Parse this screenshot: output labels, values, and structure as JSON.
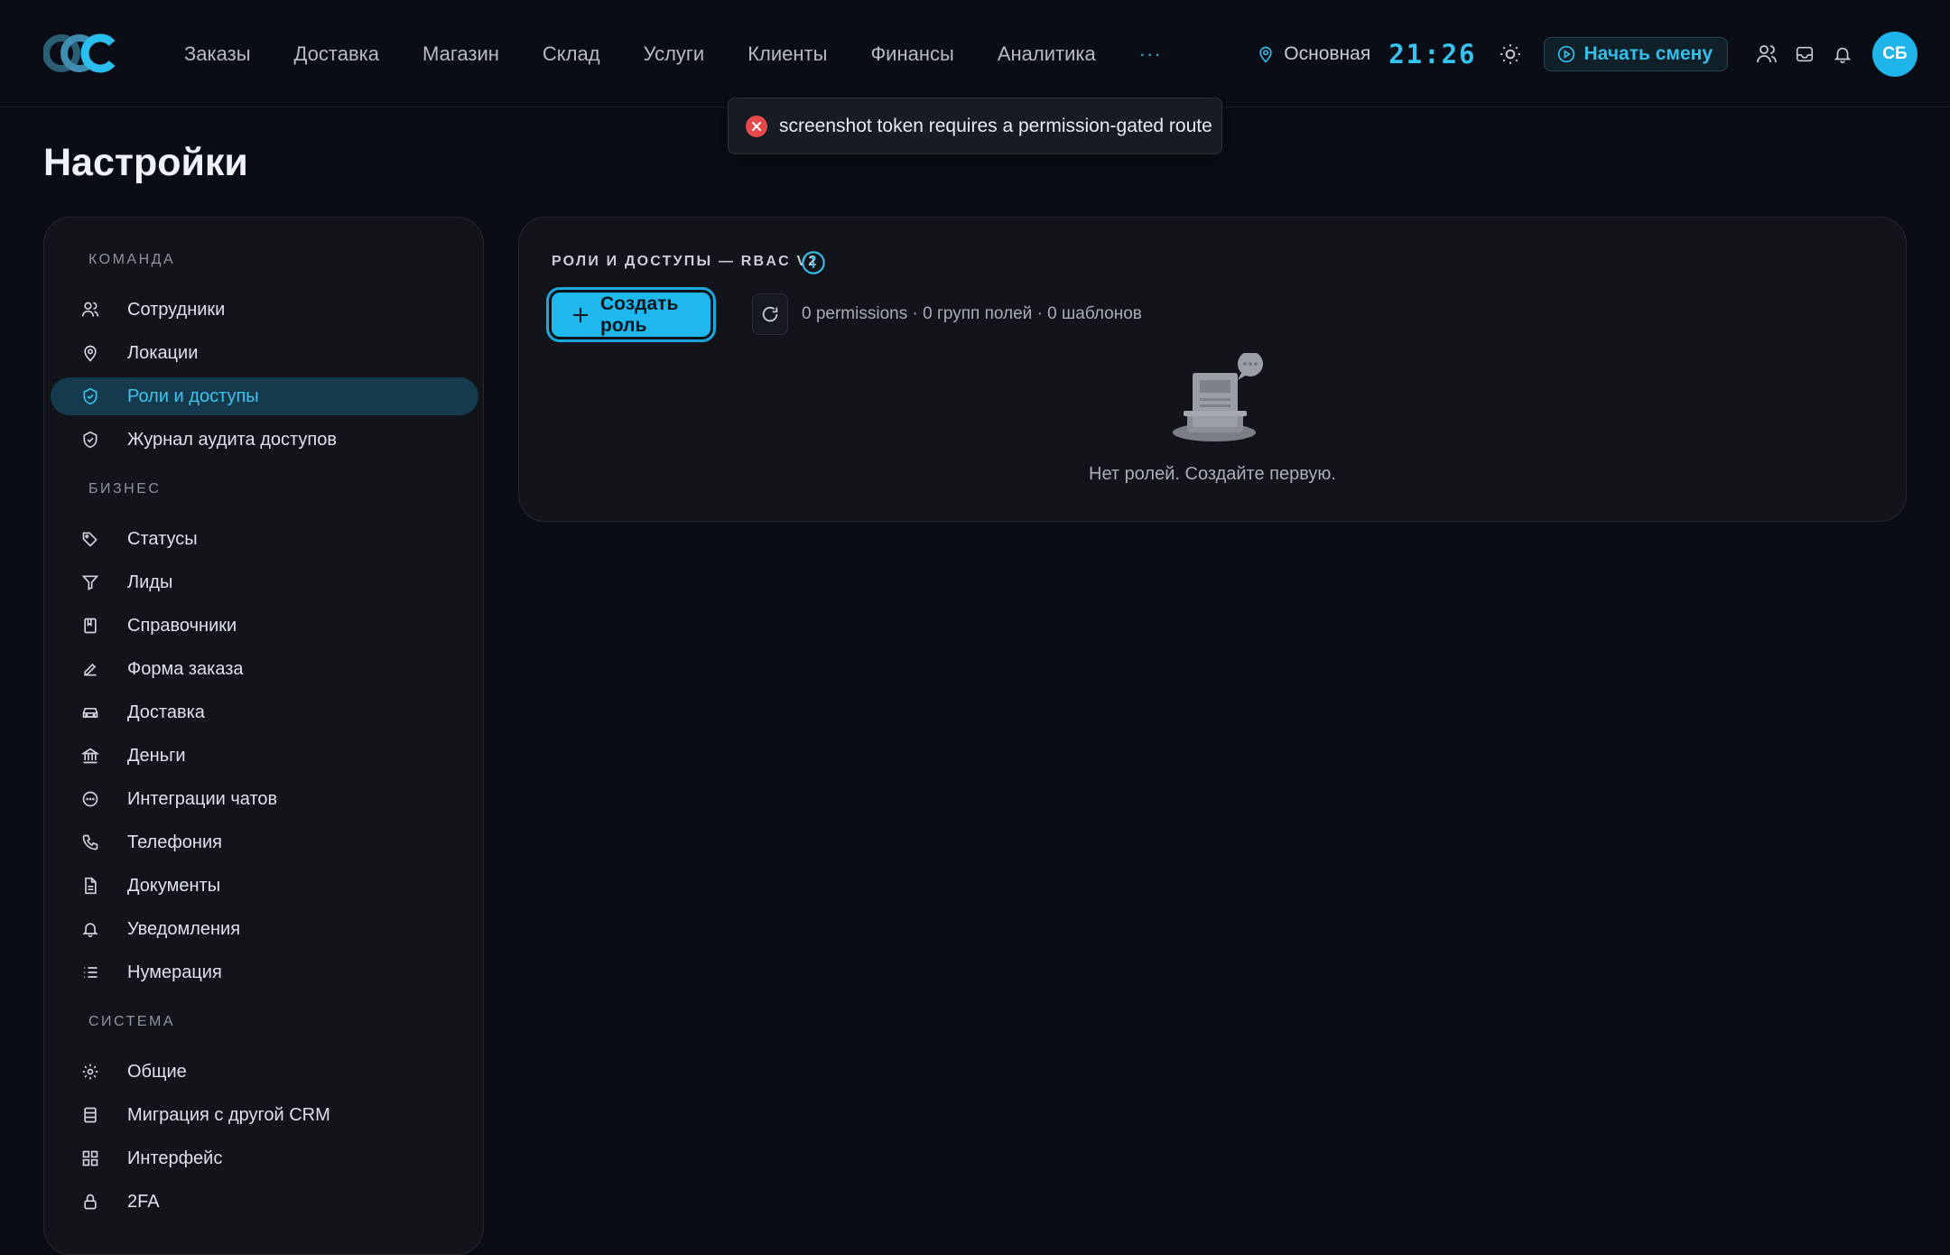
{
  "header": {
    "nav": [
      "Заказы",
      "Доставка",
      "Магазин",
      "Склад",
      "Услуги",
      "Клиенты",
      "Финансы",
      "Аналитика"
    ],
    "nav_more": "···",
    "location": "Основная",
    "clock": "21:26",
    "shift_button": "Начать смену",
    "avatar_initials": "СБ"
  },
  "toast": {
    "message": "screenshot token requires a permission-gated route",
    "type": "error"
  },
  "page": {
    "title": "Настройки"
  },
  "sidebar": {
    "sections": [
      {
        "title": "КОМАНДА",
        "items": [
          {
            "label": "Сотрудники",
            "icon": "users-icon"
          },
          {
            "label": "Локации",
            "icon": "map-pin-icon"
          },
          {
            "label": "Роли и доступы",
            "icon": "shield-check-icon",
            "active": true
          },
          {
            "label": "Журнал аудита доступов",
            "icon": "shield-check-icon"
          }
        ]
      },
      {
        "title": "БИЗНЕС",
        "items": [
          {
            "label": "Статусы",
            "icon": "tags-icon"
          },
          {
            "label": "Лиды",
            "icon": "funnel-icon"
          },
          {
            "label": "Справочники",
            "icon": "book-icon"
          },
          {
            "label": "Форма заказа",
            "icon": "pencil-icon"
          },
          {
            "label": "Доставка",
            "icon": "car-icon"
          },
          {
            "label": "Деньги",
            "icon": "bank-icon"
          },
          {
            "label": "Интеграции чатов",
            "icon": "chat-icon"
          },
          {
            "label": "Телефония",
            "icon": "phone-icon"
          },
          {
            "label": "Документы",
            "icon": "document-icon"
          },
          {
            "label": "Уведомления",
            "icon": "bell-icon"
          },
          {
            "label": "Нумерация",
            "icon": "list-icon"
          }
        ]
      },
      {
        "title": "СИСТЕМА",
        "items": [
          {
            "label": "Общие",
            "icon": "gear-icon"
          },
          {
            "label": "Миграция с другой CRM",
            "icon": "database-icon"
          },
          {
            "label": "Интерфейс",
            "icon": "grid-icon"
          },
          {
            "label": "2FA",
            "icon": "lock-icon"
          }
        ]
      }
    ]
  },
  "main": {
    "card_title": "РОЛИ И ДОСТУПЫ — RBAC V2",
    "create_button": "Создать роль",
    "counts": "0 permissions · 0 групп полей · 0 шаблонов",
    "empty_text": "Нет ролей. Создайте первую."
  },
  "colors": {
    "background": "#0a0d16",
    "accent": "#1fb8ec",
    "error": "#e5484d"
  }
}
